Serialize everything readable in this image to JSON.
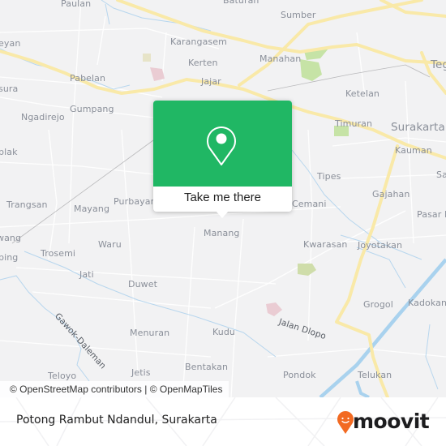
{
  "map": {
    "places": [
      {
        "id": "baturan",
        "label": "Baturan"
      },
      {
        "id": "paulan",
        "label": "Paulan"
      },
      {
        "id": "sumber",
        "label": "Sumber"
      },
      {
        "id": "karangasem",
        "label": "Karangasem"
      },
      {
        "id": "gumpang-top",
        "label": "eyan"
      },
      {
        "id": "kerten",
        "label": "Kerten"
      },
      {
        "id": "manahan",
        "label": "Manahan"
      },
      {
        "id": "pabelan",
        "label": "Pabelan"
      },
      {
        "id": "jajar",
        "label": "Jajar"
      },
      {
        "id": "sura",
        "label": "sura"
      },
      {
        "id": "ketelan",
        "label": "Ketelan"
      },
      {
        "id": "ngadirejo",
        "label": "Ngadirejo"
      },
      {
        "id": "gumpang",
        "label": "Gumpang"
      },
      {
        "id": "timuran",
        "label": "Timuran"
      },
      {
        "id": "surakarta",
        "label": "Surakarta"
      },
      {
        "id": "kauman",
        "label": "Kauman"
      },
      {
        "id": "blak",
        "label": "blak"
      },
      {
        "id": "tipes",
        "label": "Tipes"
      },
      {
        "id": "sa",
        "label": "Sa"
      },
      {
        "id": "trangsan",
        "label": "Trangsan"
      },
      {
        "id": "mayang",
        "label": "Mayang"
      },
      {
        "id": "purbayan",
        "label": "Purbayan"
      },
      {
        "id": "cemani",
        "label": "Cemani"
      },
      {
        "id": "gajahan",
        "label": "Gajahan"
      },
      {
        "id": "pasar-kliwon",
        "label": "Pasar K"
      },
      {
        "id": "manang",
        "label": "Manang"
      },
      {
        "id": "wang",
        "label": "wang"
      },
      {
        "id": "waru",
        "label": "Waru"
      },
      {
        "id": "kwarasan",
        "label": "Kwarasan"
      },
      {
        "id": "joyotakan",
        "label": "Joyotakan"
      },
      {
        "id": "bing",
        "label": "bing"
      },
      {
        "id": "trosemi",
        "label": "Trosemi"
      },
      {
        "id": "jati",
        "label": "Jati"
      },
      {
        "id": "duwet",
        "label": "Duwet"
      },
      {
        "id": "grogol",
        "label": "Grogol"
      },
      {
        "id": "kadokan",
        "label": "Kadokan"
      },
      {
        "id": "menuran",
        "label": "Menuran"
      },
      {
        "id": "kudu",
        "label": "Kudu"
      },
      {
        "id": "bentakan",
        "label": "Bentakan"
      },
      {
        "id": "jetis",
        "label": "Jetis"
      },
      {
        "id": "pondok",
        "label": "Pondok"
      },
      {
        "id": "telukan",
        "label": "Telukan"
      },
      {
        "id": "teloyo",
        "label": "Teloyo"
      },
      {
        "id": "tegal",
        "label": "Teg"
      }
    ],
    "streets": [
      {
        "id": "gawok-daleman",
        "label": "Gawok-Daleman"
      },
      {
        "id": "jalan-dlopo",
        "label": "Jalan Dlopo"
      }
    ],
    "attribution": "© OpenStreetMap contributors | © OpenMapTiles",
    "colors": {
      "background": "#f2f2f3",
      "major_road": "#f9e9a8",
      "minor_road": "#ffffff",
      "water": "#a9d2ee",
      "park": "#c6e3a6",
      "popup_green": "#20b764"
    }
  },
  "popup": {
    "icon": "map-pin-icon",
    "action_label": "Take me there"
  },
  "footer": {
    "title": "Potong Rambut Ndandul, Surakarta",
    "brand": "moovit",
    "brand_color": "#f26a22"
  }
}
